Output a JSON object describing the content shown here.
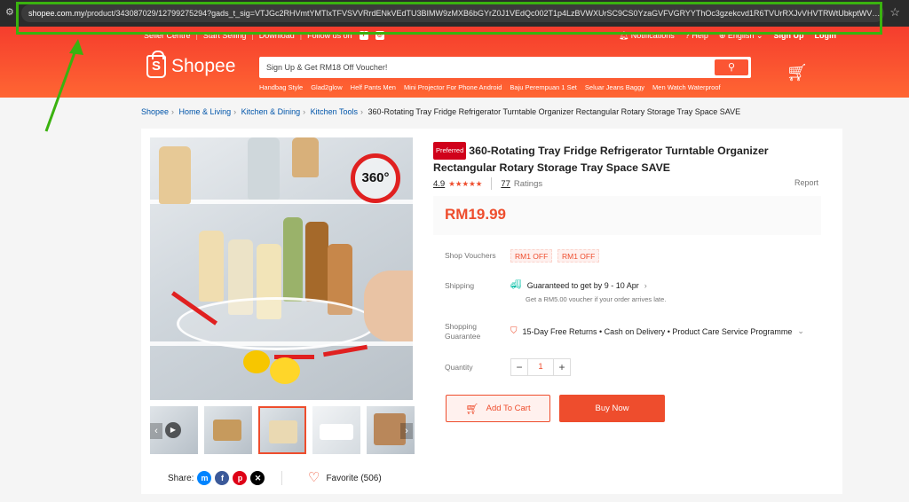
{
  "browser": {
    "url_host": "shopee.com.my",
    "url_path": "/product/343087029/12799275294?gads_t_sig=VTJGc2RHVmtYMTlxTFVSVVRrdENkVEdTU3BIMW9zMXB6bGYrZ0J1VEdQc002T1p4LzBVWXUrSC9CS0YzaGVFVGRYYThOc3gzekcvd1R6TVUrRXJvVHVTRWtUbkptWVFvRWxrN...",
    "icons": [
      "site-settings-icon",
      "star-icon"
    ],
    "highlight_color": "#3ab20f"
  },
  "header": {
    "top_links": [
      "Seller Centre",
      "Start Selling",
      "Download",
      "Follow us on"
    ],
    "right_links": [
      "Notifications",
      "Help",
      "English",
      "Sign Up",
      "Login"
    ],
    "logo_text": "Shopee",
    "search_placeholder": "Sign Up & Get RM18 Off Voucher!",
    "suggestions": [
      "Handbag Style",
      "Glad2glow",
      "Helf Pants Men",
      "Mini Projector For Phone Android",
      "Baju Perempuan 1 Set",
      "Seluar Jeans Baggy",
      "Men Watch Waterproof"
    ],
    "brand_color": "#f53d2d"
  },
  "breadcrumb": {
    "items": [
      "Shopee",
      "Home & Living",
      "Kitchen & Dining",
      "Kitchen Tools"
    ],
    "current": "360-Rotating Tray Fridge Refrigerator Turntable Organizer Rectangular Rotary Storage Tray Space SAVE"
  },
  "product": {
    "badge": "Preferred",
    "title": "360-Rotating Tray Fridge Refrigerator Turntable Organizer Rectangular Rotary Storage Tray Space SAVE",
    "rating": "4.9",
    "stars": "★★★★★",
    "ratings_count": "77",
    "ratings_label": "Ratings",
    "report": "Report",
    "price": "RM19.99",
    "image_badge": "360°",
    "shop_vouchers_label": "Shop Vouchers",
    "vouchers": [
      "RM1 OFF",
      "RM1 OFF"
    ],
    "shipping_label": "Shipping",
    "shipping_text": "Guaranteed to get by 9 - 10 Apr",
    "shipping_sub": "Get a RM5.00 voucher if your order arrives late.",
    "guarantee_label_1": "Shopping",
    "guarantee_label_2": "Guarantee",
    "guarantee_text": "15-Day Free Returns • Cash on Delivery • Product Care Service Programme",
    "quantity_label": "Quantity",
    "quantity": "1",
    "add_to_cart": "Add To Cart",
    "buy_now": "Buy Now",
    "share_label": "Share:",
    "favorite": "Favorite (506)"
  }
}
